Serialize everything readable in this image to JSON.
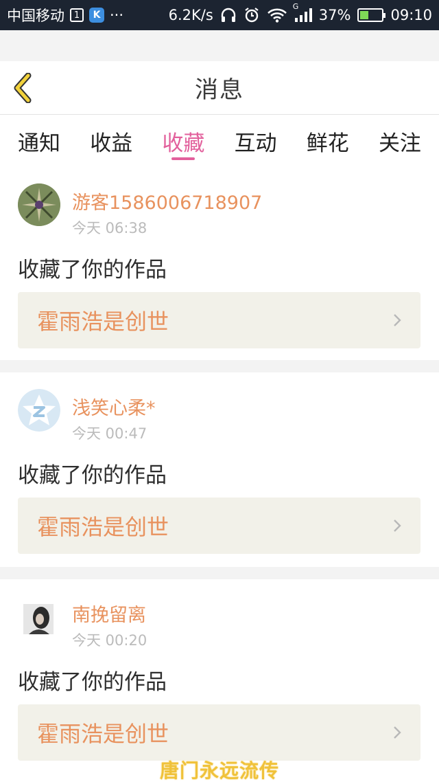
{
  "status_bar": {
    "carrier": "中国移动",
    "sim_badge": "1",
    "app_badge": "K",
    "more": "···",
    "speed": "6.2K/s",
    "network_type": "G",
    "battery": "37%",
    "battery_level": 0.37,
    "time": "09:10"
  },
  "header": {
    "title": "消息",
    "back_icon": "chevron-left-icon"
  },
  "tabs": [
    {
      "label": "通知",
      "active": false
    },
    {
      "label": "收益",
      "active": false
    },
    {
      "label": "收藏",
      "active": true
    },
    {
      "label": "互动",
      "active": false
    },
    {
      "label": "鲜花",
      "active": false
    },
    {
      "label": "关注",
      "active": false
    }
  ],
  "messages": [
    {
      "user": "游客1586006718907",
      "time": "今天 06:38",
      "action": "收藏了你的作品",
      "work": "霍雨浩是创世"
    },
    {
      "user": "浅笑心柔*",
      "time": "今天 00:47",
      "action": "收藏了你的作品",
      "work": "霍雨浩是创世"
    },
    {
      "user": "南挽留离",
      "time": "今天 00:20",
      "action": "收藏了你的作品",
      "work": "霍雨浩是创世"
    }
  ],
  "watermark": "唐门永远流传",
  "colors": {
    "accent": "#e2609c",
    "username": "#e8925e",
    "back_icon": "#f2d23c",
    "status_bar": "#1c2431"
  }
}
